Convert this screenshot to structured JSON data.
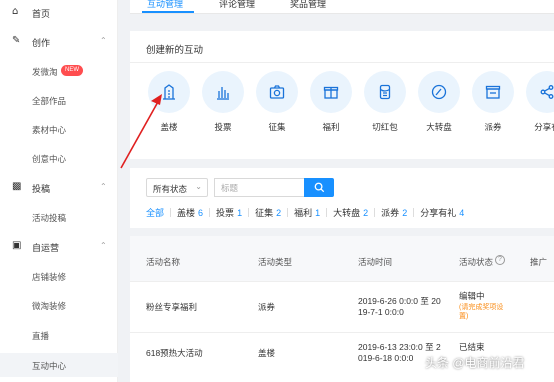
{
  "sidebar": {
    "home": {
      "label": "首页",
      "icon": "home-icon"
    },
    "create": {
      "label": "创作",
      "icon": "pen-icon"
    },
    "create_items": [
      {
        "label": "发微淘",
        "badge": "NEW"
      },
      {
        "label": "全部作品"
      },
      {
        "label": "素材中心"
      },
      {
        "label": "创意中心"
      }
    ],
    "post": {
      "label": "投稿",
      "icon": "document-icon"
    },
    "post_items": [
      {
        "label": "活动投稿"
      }
    ],
    "ops": {
      "label": "自运营",
      "icon": "box-icon"
    },
    "ops_items": [
      {
        "label": "店铺装修"
      },
      {
        "label": "微淘装修"
      },
      {
        "label": "直播"
      },
      {
        "label": "互动中心"
      }
    ]
  },
  "tabs": [
    {
      "label": "互动管理"
    },
    {
      "label": "评论管理"
    },
    {
      "label": "奖品管理"
    }
  ],
  "create_panel": {
    "title": "创建新的互动",
    "tools": [
      {
        "label": "盖楼",
        "icon": "building-icon"
      },
      {
        "label": "投票",
        "icon": "bar-chart-icon"
      },
      {
        "label": "征集",
        "icon": "camera-icon"
      },
      {
        "label": "福利",
        "icon": "gift-icon"
      },
      {
        "label": "切红包",
        "icon": "red-envelope-icon"
      },
      {
        "label": "大转盘",
        "icon": "wheel-icon"
      },
      {
        "label": "派券",
        "icon": "coupon-icon"
      },
      {
        "label": "分享有",
        "icon": "share-icon"
      }
    ]
  },
  "filter": {
    "status_value": "所有状态",
    "search_placeholder": "标题",
    "categories": [
      {
        "label": "全部",
        "count": ""
      },
      {
        "label": "盖楼",
        "count": "6"
      },
      {
        "label": "投票",
        "count": "1"
      },
      {
        "label": "征集",
        "count": "2"
      },
      {
        "label": "福利",
        "count": "1"
      },
      {
        "label": "大转盘",
        "count": "2"
      },
      {
        "label": "派券",
        "count": "2"
      },
      {
        "label": "分享有礼",
        "count": "4"
      }
    ]
  },
  "table": {
    "headers": [
      "活动名称",
      "活动类型",
      "活动时间",
      "活动状态",
      "推广"
    ],
    "rows": [
      {
        "name": "粉丝专享福利",
        "type": "派券",
        "time1": "2019-6-26 0:0:0 至 20",
        "time2": "19-7-1 0:0:0",
        "status": "编辑中",
        "note1": "(请完成奖项设",
        "note2": "置)"
      },
      {
        "name": "618预热大活动",
        "type": "盖楼",
        "time1": "2019-6-13 23:0:0 至 2",
        "time2": "019-6-18 0:0:0",
        "status": "已结束",
        "note1": "",
        "note2": ""
      }
    ]
  },
  "watermark": "头条 @电商前沿君",
  "colors": {
    "accent": "#1890ff",
    "badge": "#ff4d4f",
    "arrow": "#e02020",
    "warning": "#fa8c16"
  }
}
